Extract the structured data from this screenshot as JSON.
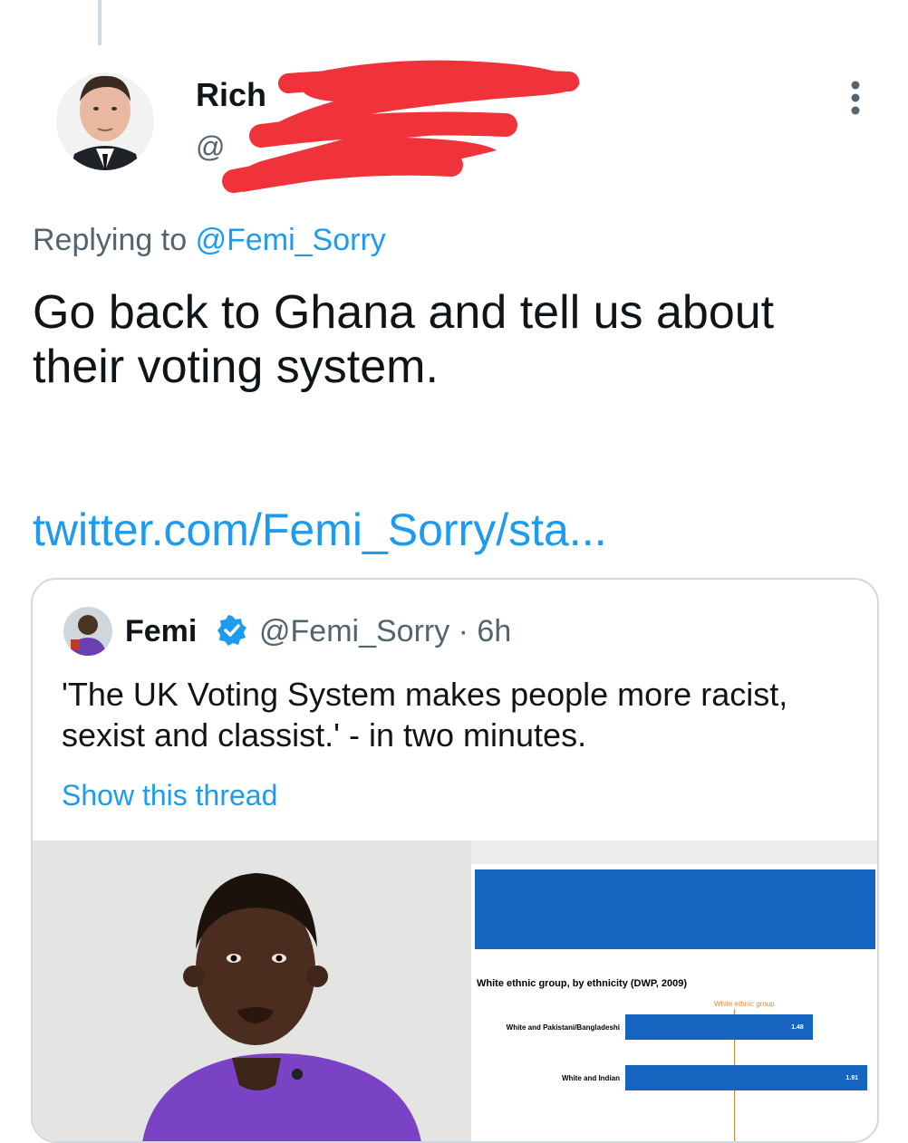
{
  "tweet": {
    "author_name_visible": "Rich",
    "handle_visible": "@",
    "reply_prefix": "Replying to",
    "reply_mention": "@Femi_Sorry",
    "text": "Go back to Ghana and tell us about their voting system.",
    "link": "twitter.com/Femi_Sorry/sta..."
  },
  "quote": {
    "name": "Femi",
    "handle_time": "@Femi_Sorry · 6h",
    "text": "'The UK Voting System makes people more racist, sexist and classist.' - in two minutes.",
    "show_thread": "Show this thread"
  },
  "chart_data": {
    "type": "bar",
    "title": "White ethnic group, by ethnicity (DWP, 2009)",
    "legend": "White ethnic group",
    "categories": [
      "White and Pakistani/Bangladeshi",
      "White and Indian"
    ],
    "values": [
      1.48,
      1.91
    ]
  },
  "colors": {
    "link_blue": "#1d9bf0",
    "redaction_red": "#f0333a",
    "chart_blue": "#1565c0",
    "muted_text": "#536471"
  },
  "icons": {
    "more": "more-vertical-icon",
    "verified": "verified-badge-icon"
  }
}
